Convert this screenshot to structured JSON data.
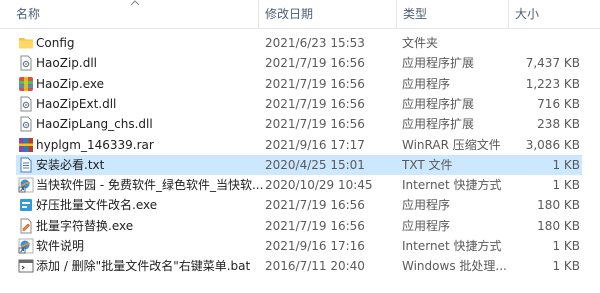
{
  "columns": {
    "name": "名称",
    "date": "修改日期",
    "type": "类型",
    "size": "大小"
  },
  "files": [
    {
      "name": "Config",
      "date": "2021/6/23 15:53",
      "type": "文件夹",
      "size": "",
      "icon": "folder-icon"
    },
    {
      "name": "HaoZip.dll",
      "date": "2021/7/19 16:56",
      "type": "应用程序扩展",
      "size": "7,437 KB",
      "icon": "dll-file-icon"
    },
    {
      "name": "HaoZip.exe",
      "date": "2021/7/19 16:56",
      "type": "应用程序",
      "size": "1,223 KB",
      "icon": "haozip-app-icon"
    },
    {
      "name": "HaoZipExt.dll",
      "date": "2021/7/19 16:56",
      "type": "应用程序扩展",
      "size": "716 KB",
      "icon": "dll-file-icon"
    },
    {
      "name": "HaoZipLang_chs.dll",
      "date": "2021/7/19 16:56",
      "type": "应用程序扩展",
      "size": "238 KB",
      "icon": "dll-file-icon"
    },
    {
      "name": "hyplgm_146339.rar",
      "date": "2021/9/16 17:17",
      "type": "WinRAR 压缩文件",
      "size": "3,086 KB",
      "icon": "rar-archive-icon"
    },
    {
      "name": "安装必看.txt",
      "date": "2020/4/25 15:01",
      "type": "TXT 文件",
      "size": "1 KB",
      "icon": "text-file-icon",
      "selected": true
    },
    {
      "name": "当快软件园 - 免费软件_绿色软件_当快软...",
      "date": "2020/10/29 10:45",
      "type": "Internet 快捷方式",
      "size": "1 KB",
      "icon": "internet-shortcut-icon"
    },
    {
      "name": "好压批量文件改名.exe",
      "date": "2021/7/19 16:56",
      "type": "应用程序",
      "size": "180 KB",
      "icon": "rename-app-icon"
    },
    {
      "name": "批量字符替换.exe",
      "date": "2021/7/19 16:56",
      "type": "应用程序",
      "size": "180 KB",
      "icon": "replace-app-icon"
    },
    {
      "name": "软件说明",
      "date": "2021/9/16 17:16",
      "type": "Internet 快捷方式",
      "size": "1 KB",
      "icon": "internet-shortcut-icon"
    },
    {
      "name": "添加 / 删除\"批量文件改名\"右键菜单.bat",
      "date": "2016/7/11 20:40",
      "type": "Windows 批处理...",
      "size": "1 KB",
      "icon": "batch-file-icon"
    }
  ],
  "colors": {
    "selected_row": "#cce8ff",
    "header_text": "#4c607a",
    "folder": "#f5c542"
  }
}
